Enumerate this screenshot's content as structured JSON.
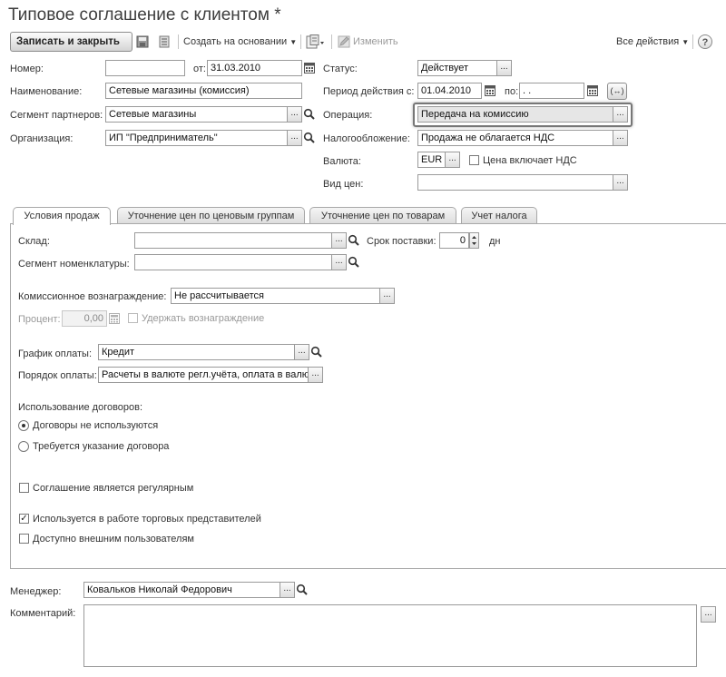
{
  "window": {
    "title": "Типовое соглашение с клиентом *"
  },
  "toolbar": {
    "save_close": "Записать и закрыть",
    "create_based_on": "Создать на основании",
    "edit": "Изменить",
    "all_actions": "Все действия",
    "help": "?"
  },
  "header": {
    "number_label": "Номер:",
    "number_value": "",
    "date_label": "от:",
    "date_value": "31.03.2010",
    "name_label": "Наименование:",
    "name_value": "Сетевые магазины (комиссия)",
    "segment_label": "Сегмент партнеров:",
    "segment_value": "Сетевые магазины",
    "org_label": "Организация:",
    "org_value": "ИП \"Предприниматель\"",
    "status_label": "Статус:",
    "status_value": "Действует",
    "period_label": "Период действия с:",
    "period_from": "01.04.2010",
    "period_to_label": "по:",
    "period_to": " .  .",
    "period_btn": "(↔)",
    "operation_label": "Операция:",
    "operation_value": "Передача на комиссию",
    "tax_label": "Налогообложение:",
    "tax_value": "Продажа не облагается НДС",
    "currency_label": "Валюта:",
    "currency_value": "EUR",
    "price_incl_vat": "Цена включает НДС",
    "price_type_label": "Вид цен:",
    "price_type_value": ""
  },
  "tabs": [
    {
      "label": "Условия продаж"
    },
    {
      "label": "Уточнение цен по ценовым группам"
    },
    {
      "label": "Уточнение цен по товарам"
    },
    {
      "label": "Учет налога"
    }
  ],
  "sales": {
    "warehouse_label": "Склад:",
    "warehouse_value": "",
    "delivery_label": "Срок поставки:",
    "delivery_value": "0",
    "delivery_unit": "дн",
    "nom_segment_label": "Сегмент номенклатуры:",
    "nom_segment_value": "",
    "commission_label": "Комиссионное вознаграждение:",
    "commission_value": "Не рассчитывается",
    "percent_label": "Процент:",
    "percent_value": "0,00",
    "withhold_label": "Удержать вознаграждение",
    "payment_schedule_label": "График оплаты:",
    "payment_schedule_value": "Кредит",
    "payment_order_label": "Порядок оплаты:",
    "payment_order_value": "Расчеты в валюте регл.учёта, оплата в валю",
    "contracts_heading": "Использование договоров:",
    "contracts_not_used": "Договоры не используются",
    "contracts_required": "Требуется указание договора",
    "regular_label": "Соглашение является регулярным",
    "reps_label": "Используется в работе торговых представителей",
    "external_label": "Доступно внешним пользователям"
  },
  "footer": {
    "manager_label": "Менеджер:",
    "manager_value": "Ковальков Николай Федорович",
    "comment_label": "Комментарий:",
    "comment_value": ""
  },
  "icons": {
    "select_button": "...",
    "search": "search-icon",
    "calendar": "calendar-icon",
    "save": "floppy-icon",
    "list": "list-icon",
    "report": "report-icon",
    "pencil": "pencil-icon"
  }
}
